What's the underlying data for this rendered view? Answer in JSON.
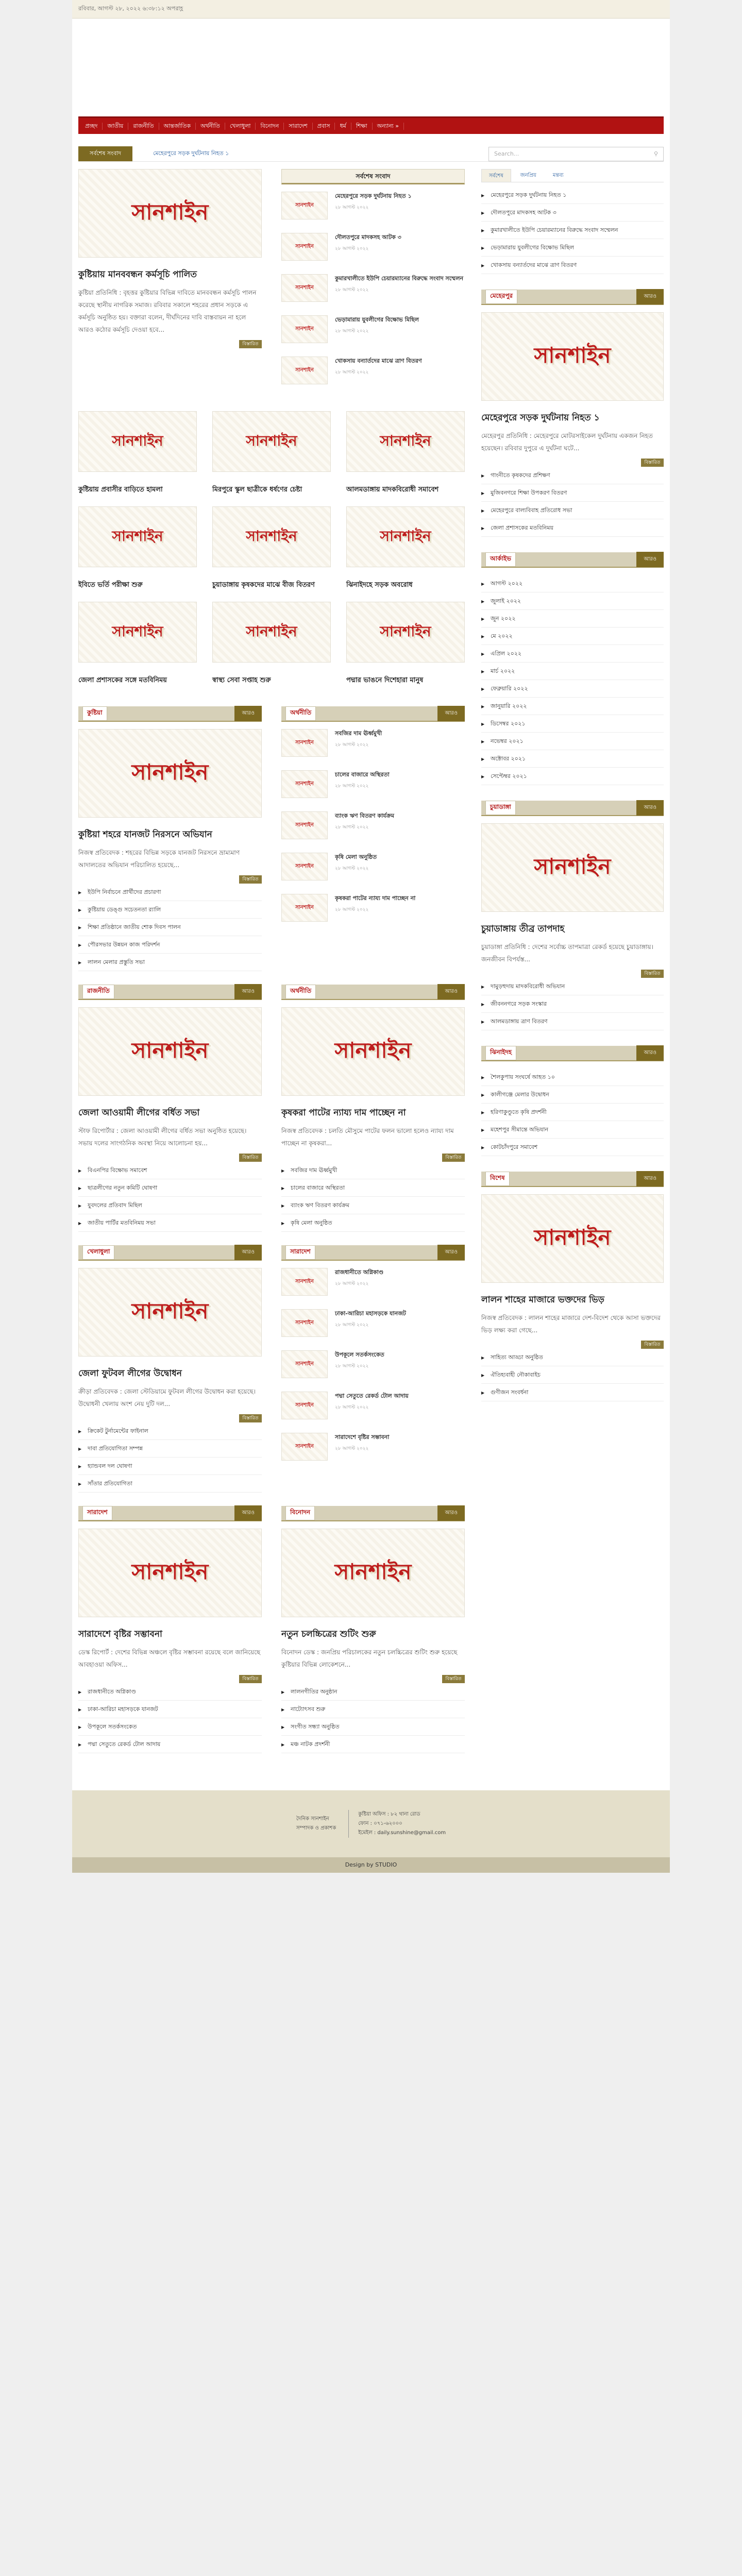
{
  "topbar": "রবিবার, আগস্ট ২৮, ২০২২ ৬:৩৮:১২ অপরাহ্ণ",
  "nav": [
    "প্রচ্ছদ",
    "জাতীয়",
    "রাজনীতি",
    "আন্তর্জাতিক",
    "অর্থনীতি",
    "খেলাধুলা",
    "বিনোদন",
    "সারাদেশ",
    "প্রবাস",
    "ধর্ম",
    "শিক্ষা",
    "অন্যান্য »"
  ],
  "ticker": {
    "label": "সর্বশেষ সংবাদ",
    "text": "মেহেরপুরে সড়ক দুর্ঘটনায় নিহত ১",
    "search_placeholder": "Search..."
  },
  "logo": "সানশাইন",
  "lead": {
    "title": "কুষ্টিয়ায় মানববন্ধন কর্মসূচি পালিত",
    "excerpt": "কুষ্টিয়া প্রতিনিধি : বৃহত্তর কুষ্টিয়ার বিভিন্ন দাবিতে মানববন্ধন কর্মসূচি পালন করেছে স্থানীয় নাগরিক সমাজ। রবিবার সকালে শহরের প্রধান সড়কে এ কর্মসূচি অনুষ্ঠিত হয়। বক্তারা বলেন, দীর্ঘদিনের দাবি বাস্তবায়ন না হলে আরও কঠোর কর্মসূচি দেওয়া হবে..."
  },
  "latest": {
    "heading": "সর্বশেষ সংবাদ",
    "items": [
      "মেহেরপুরে সড়ক দুর্ঘটনায় নিহত ১",
      "দৌলতপুরে মাদকসহ আটক ৩",
      "কুমারখালীতে ইউপি চেয়ারম্যানের বিরুদ্ধে সংবাদ সম্মেলন",
      "ভেড়ামারায় যুবলীগের বিক্ষোভ মিছিল",
      "খোকসায় বন্যার্তদের মাঝে ত্রাণ বিতরণ"
    ]
  },
  "grid": [
    "কুষ্টিয়ায় প্রবাসীর বাড়িতে হামলা",
    "মিরপুরে স্কুল ছাত্রীকে ধর্ষণের চেষ্টা",
    "আলমডাঙ্গায় মাদকবিরোধী সমাবেশ",
    "ইবিতে ভর্তি পরীক্ষা শুরু",
    "চুয়াডাঙ্গায় কৃষকদের মাঝে বীজ বিতরণ",
    "ঝিনাইদহে সড়ক অবরোধ",
    "জেলা প্রশাসকের সঙ্গে মতবিনিময়",
    "স্বাস্থ্য সেবা সপ্তাহ শুরু",
    "পদ্মার ভাঙনে দিশেহারা মানুষ"
  ],
  "sections": [
    {
      "title": "কুষ্টিয়া",
      "post": "কুষ্টিয়া শহরে যানজট নিরসনে অভিযান",
      "excerpt": "নিজস্ব প্রতিবেদক : শহরের বিভিন্ন সড়কে যানজট নিরসনে ভ্রাম্যমাণ আদালতের অভিযান পরিচালিত হয়েছে...",
      "items": [
        "ইউপি নির্বাচনে প্রার্থীদের প্রচারণা",
        "কুষ্টিয়ায় ডেঙ্গু সচেতনতা র‌্যালি",
        "শিক্ষা প্রতিষ্ঠানে জাতীয় শোক দিবস পালন",
        "পৌরসভার উন্নয়ন কাজ পরিদর্শন",
        "লালন মেলার প্রস্তুতি সভা"
      ]
    },
    {
      "title": "রাজনীতি",
      "post": "জেলা আওয়ামী লীগের বর্ধিত সভা",
      "excerpt": "স্টাফ রিপোর্টার : জেলা আওয়ামী লীগের বর্ধিত সভা অনুষ্ঠিত হয়েছে। সভায় দলের সাংগঠনিক অবস্থা নিয়ে আলোচনা হয়...",
      "items": [
        "বিএনপির বিক্ষোভ সমাবেশ",
        "ছাত্রলীগের নতুন কমিটি ঘোষণা",
        "যুবদলের প্রতিবাদ মিছিল",
        "জাতীয় পার্টির মতবিনিময় সভা"
      ]
    },
    {
      "title": "অর্থনীতি",
      "post": "কৃষকরা পাটের ন্যায্য দাম পাচ্ছেন না",
      "excerpt": "নিজস্ব প্রতিবেদক : চলতি মৌসুমে পাটের ফলন ভালো হলেও ন্যায্য দাম পাচ্ছেন না কৃষকরা...",
      "items": [
        "সবজির দাম ঊর্ধ্বমুখী",
        "চালের বাজারে অস্থিরতা",
        "ব্যাংক ঋণ বিতরণ কার্যক্রম",
        "কৃষি মেলা অনুষ্ঠিত"
      ]
    },
    {
      "title": "খেলাধুলা",
      "post": "জেলা ফুটবল লীগের উদ্বোধন",
      "excerpt": "ক্রীড়া প্রতিবেদক : জেলা স্টেডিয়ামে ফুটবল লীগের উদ্বোধন করা হয়েছে। উদ্বোধনী খেলায় অংশ নেয় দুটি দল...",
      "items": [
        "ক্রিকেট টুর্নামেন্টের ফাইনাল",
        "দাবা প্রতিযোগিতা সম্পন্ন",
        "হ্যান্ডবল দল ঘোষণা",
        "সাঁতার প্রতিযোগিতা"
      ]
    },
    {
      "title": "সারাদেশ",
      "post": "সারাদেশে বৃষ্টির সম্ভাবনা",
      "excerpt": "ডেস্ক রিপোর্ট : দেশের বিভিন্ন অঞ্চলে বৃষ্টির সম্ভাবনা রয়েছে বলে জানিয়েছে আবহাওয়া অফিস...",
      "items": [
        "রাজধানীতে অগ্নিকাণ্ড",
        "ঢাকা-আরিচা মহাসড়কে যানজট",
        "উপকূলে সতর্কসংকেত",
        "পদ্মা সেতুতে রেকর্ড টোল আদায়"
      ]
    },
    {
      "title": "বিনোদন",
      "post": "নতুন চলচ্চিত্রের শুটিং শুরু",
      "excerpt": "বিনোদন ডেস্ক : জনপ্রিয় পরিচালকের নতুন চলচ্চিত্রের শুটিং শুরু হয়েছে কুষ্টিয়ার বিভিন্ন লোকেশনে...",
      "items": [
        "লালনগীতির অনুষ্ঠান",
        "নাট্যোৎসব শুরু",
        "সংগীত সন্ধ্যা অনুষ্ঠিত",
        "মঞ্চ নাটক প্রদর্শনী"
      ]
    }
  ],
  "sidebar": {
    "tabs": [
      "সর্বশেষ",
      "জনপ্রিয়",
      "মন্তব্য"
    ],
    "tab_items": [
      "মেহেরপুরে সড়ক দুর্ঘটনায় নিহত ১",
      "দৌলতপুরে মাদকসহ আটক ৩",
      "কুমারখালীতে ইউপি চেয়ারম্যানের বিরুদ্ধে সংবাদ সম্মেলন",
      "ভেড়ামারায় যুবলীগের বিক্ষোভ মিছিল",
      "খোকসায় বন্যার্তদের মাঝে ত্রাণ বিতরণ"
    ],
    "b1": {
      "title": "মেহেরপুর",
      "post": "মেহেরপুরে সড়ক দুর্ঘটনায় নিহত ১",
      "excerpt": "মেহেরপুর প্রতিনিধি : মেহেরপুরে মোটরসাইকেল দুর্ঘটনায় একজন নিহত হয়েছেন। রবিবার দুপুরে এ দুর্ঘটনা ঘটে...",
      "items": [
        "গাংনীতে কৃষকদের প্রশিক্ষণ",
        "মুজিবনগরে শিক্ষা উপকরণ বিতরণ",
        "মেহেরপুরে বাল্যবিবাহ প্রতিরোধ সভা",
        "জেলা প্রশাসকের মতবিনিময়"
      ]
    },
    "b2": {
      "title": "আর্কাইভ",
      "items": [
        "আগস্ট ২০২২",
        "জুলাই ২০২২",
        "জুন ২০২২",
        "মে ২০২২",
        "এপ্রিল ২০২২",
        "মার্চ ২০২২",
        "ফেব্রুয়ারি ২০২২",
        "জানুয়ারি ২০২২",
        "ডিসেম্বর ২০২১",
        "নভেম্বর ২০২১",
        "অক্টোবর ২০২১",
        "সেপ্টেম্বর ২০২১"
      ]
    },
    "b3": {
      "title": "চুয়াডাঙ্গা",
      "post": "চুয়াডাঙ্গায় তীব্র তাপদাহ",
      "excerpt": "চুয়াডাঙ্গা প্রতিনিধি : দেশের সর্বোচ্চ তাপমাত্রা রেকর্ড হয়েছে চুয়াডাঙ্গায়। জনজীবন বিপর্যস্ত...",
      "items": [
        "দামুড়হুদায় মাদকবিরোধী অভিযান",
        "জীবননগরে সড়ক সংস্কার",
        "আলমডাঙ্গায় ত্রাণ বিতরণ"
      ]
    },
    "b4": {
      "title": "ঝিনাইদহ",
      "items": [
        "শৈলকুপায় সংঘর্ষে আহত ১০",
        "কালীগঞ্জে মেলার উদ্বোধন",
        "হরিণাকুণ্ডুতে কৃষি প্রদর্শনী",
        "মহেশপুর সীমান্তে অভিযান",
        "কোটচাঁদপুরে সমাবেশ"
      ]
    },
    "b5": {
      "title": "বিশেষ",
      "post": "লালন শাহের মাজারে ভক্তদের ভিড়",
      "excerpt": "নিজস্ব প্রতিবেদক : লালন শাহের মাজারে দেশ-বিদেশ থেকে আসা ভক্তদের ভিড় লক্ষ্য করা গেছে...",
      "items": [
        "সাহিত্য আড্ডা অনুষ্ঠিত",
        "ঐতিহ্যবাহী নৌকাবাইচ",
        "গুণীজন সংবর্ধনা"
      ]
    }
  },
  "footer": {
    "left": [
      "দৈনিক সানশাইন",
      "সম্পাদক ও প্রকাশক"
    ],
    "right": [
      "কুষ্টিয়া অফিস : ৮২ থানা রোড",
      "ফোন : ০৭১-৬২০০০",
      "ইমেইল : daily.sunshine@gmail.com"
    ],
    "design": "Design by STUDIO"
  }
}
